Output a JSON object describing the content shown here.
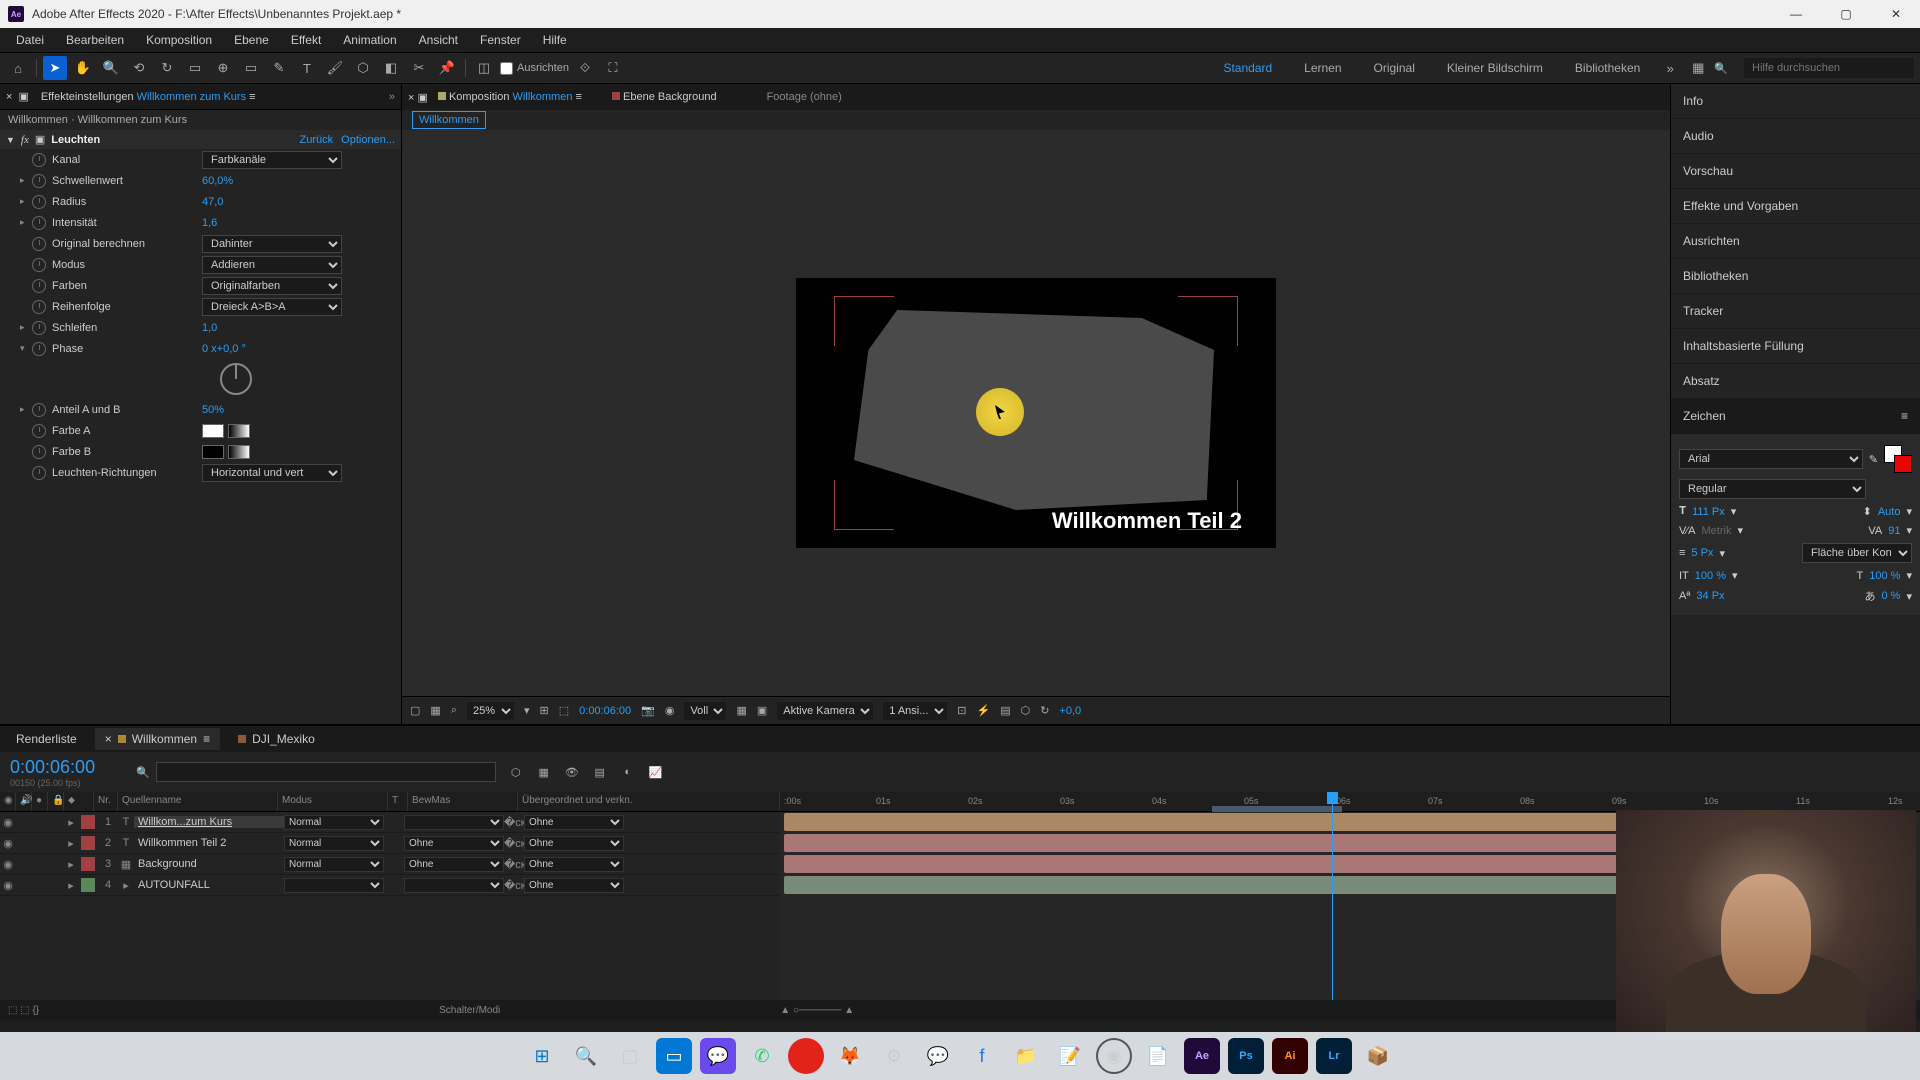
{
  "title": "Adobe After Effects 2020 - F:\\After Effects\\Unbenanntes Projekt.aep *",
  "menu": [
    "Datei",
    "Bearbeiten",
    "Komposition",
    "Ebene",
    "Effekt",
    "Animation",
    "Ansicht",
    "Fenster",
    "Hilfe"
  ],
  "toolbar_align": "Ausrichten",
  "workspaces": [
    "Standard",
    "Lernen",
    "Original",
    "Kleiner Bildschirm",
    "Bibliotheken"
  ],
  "workspace_active": "Standard",
  "help_search_ph": "Hilfe durchsuchen",
  "effect_panel": {
    "tab_prefix": "Effekteinstellungen",
    "tab_layer": "Willkommen zum Kurs",
    "breadcrumb": "Willkommen · Willkommen zum Kurs",
    "fx_name": "Leuchten",
    "link_reset": "Zurück",
    "link_options": "Optionen...",
    "props": {
      "kanal": {
        "label": "Kanal",
        "value": "Farbkanäle"
      },
      "schwellenwert": {
        "label": "Schwellenwert",
        "value": "60,0%"
      },
      "radius": {
        "label": "Radius",
        "value": "47,0"
      },
      "intensitaet": {
        "label": "Intensität",
        "value": "1,6"
      },
      "original": {
        "label": "Original berechnen",
        "value": "Dahinter"
      },
      "modus": {
        "label": "Modus",
        "value": "Addieren"
      },
      "farben": {
        "label": "Farben",
        "value": "Originalfarben"
      },
      "reihenfolge": {
        "label": "Reihenfolge",
        "value": "Dreieck A>B>A"
      },
      "schleifen": {
        "label": "Schleifen",
        "value": "1,0"
      },
      "phase": {
        "label": "Phase",
        "value": "0 x+0,0 °"
      },
      "anteil": {
        "label": "Anteil A und B",
        "value": "50%"
      },
      "farbeA": {
        "label": "Farbe A"
      },
      "farbeB": {
        "label": "Farbe B"
      },
      "richtungen": {
        "label": "Leuchten-Richtungen",
        "value": "Horizontal und vert"
      }
    }
  },
  "comp_panel": {
    "tab_label": "Komposition",
    "tab_name": "Willkommen",
    "tab2": "Ebene Background",
    "footage": "Footage (ohne)",
    "crumb": "Willkommen",
    "text_overlay": "Willkommen Teil 2"
  },
  "viewer_bar": {
    "zoom": "25%",
    "timecode": "0:00:06:00",
    "resolution": "Voll",
    "camera": "Aktive Kamera",
    "views": "1 Ansi...",
    "exposure": "+0,0"
  },
  "right_panels": [
    "Info",
    "Audio",
    "Vorschau",
    "Effekte und Vorgaben",
    "Ausrichten",
    "Bibliotheken",
    "Tracker",
    "Inhaltsbasierte Füllung",
    "Absatz",
    "Zeichen"
  ],
  "character": {
    "font": "Arial",
    "style": "Regular",
    "size": "111 Px",
    "leading": "Auto",
    "kerning": "Metrik",
    "tracking": "91",
    "stroke": "5 Px",
    "stroke_mode": "Fläche über Kon...",
    "hscale": "100 %",
    "vscale": "100 %",
    "baseline": "34 Px",
    "tsume": "0 %"
  },
  "timeline": {
    "tab_render": "Renderliste",
    "tab_active": "Willkommen",
    "tab_other": "DJI_Mexiko",
    "timecode": "0:00:06:00",
    "sub_tc": "00150 (25.00 fps)",
    "search_ph": "",
    "cols": {
      "nr": "Nr.",
      "source": "Quellenname",
      "mode": "Modus",
      "t": "T",
      "trkmat": "BewMas",
      "parent": "Übergeordnet und verkn."
    },
    "layers": [
      {
        "n": "1",
        "color": "#a04040",
        "icon": "T",
        "name": "Willkom...zum Kurs",
        "mode": "Normal",
        "trk": "",
        "parent": "Ohne",
        "sel": true
      },
      {
        "n": "2",
        "color": "#a04040",
        "icon": "T",
        "name": "Willkommen Teil 2",
        "mode": "Normal",
        "trk": "Ohne",
        "parent": "Ohne",
        "sel": false
      },
      {
        "n": "3",
        "color": "#a04040",
        "icon": "▦",
        "name": "Background",
        "mode": "Normal",
        "trk": "Ohne",
        "parent": "Ohne",
        "sel": false
      },
      {
        "n": "4",
        "color": "#5a8a5a",
        "icon": "▸",
        "name": "AUTOUNFALL",
        "mode": "",
        "trk": "",
        "parent": "Ohne",
        "sel": false
      }
    ],
    "ticks": [
      ":00s",
      "01s",
      "02s",
      "03s",
      "04s",
      "05s",
      "06s",
      "07s",
      "08s",
      "09s",
      "10s",
      "11s",
      "12s"
    ],
    "switcher": "Schalter/Modi"
  },
  "chart_data": null
}
